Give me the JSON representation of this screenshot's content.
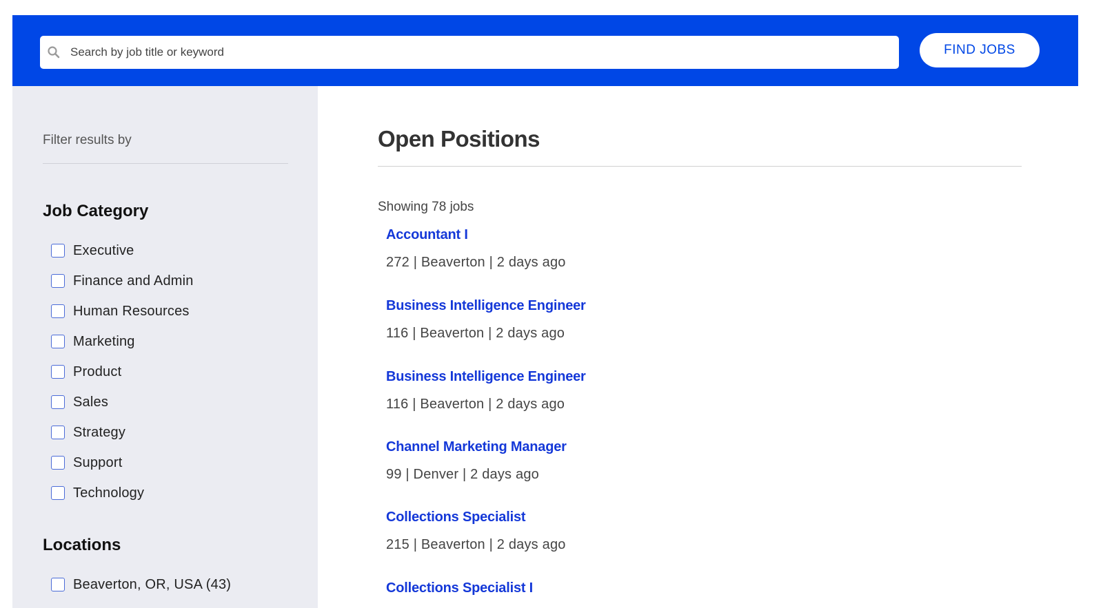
{
  "search": {
    "placeholder": "Search by job title or keyword",
    "value": "",
    "button_label": "FIND JOBS"
  },
  "sidebar": {
    "filter_title": "Filter results by",
    "job_category": {
      "title": "Job Category",
      "options": [
        "Executive",
        "Finance and Admin",
        "Human Resources",
        "Marketing",
        "Product",
        "Sales",
        "Strategy",
        "Support",
        "Technology"
      ]
    },
    "locations": {
      "title": "Locations",
      "options": [
        "Beaverton, OR, USA (43)"
      ]
    }
  },
  "main": {
    "title": "Open Positions",
    "showing": "Showing 78 jobs",
    "jobs": [
      {
        "title": "Accountant I",
        "meta": "272 | Beaverton | 2 days ago"
      },
      {
        "title": "Business Intelligence Engineer",
        "meta": "116 | Beaverton | 2 days ago"
      },
      {
        "title": "Business Intelligence Engineer",
        "meta": "116 | Beaverton | 2 days ago"
      },
      {
        "title": "Channel Marketing Manager",
        "meta": "99 | Denver | 2 days ago"
      },
      {
        "title": "Collections Specialist",
        "meta": "215 | Beaverton | 2 days ago"
      },
      {
        "title": "Collections Specialist I",
        "meta": ""
      }
    ]
  },
  "colors": {
    "header": "#0047e6",
    "link": "#1438d8",
    "sidebar_bg": "#ebecf2"
  }
}
